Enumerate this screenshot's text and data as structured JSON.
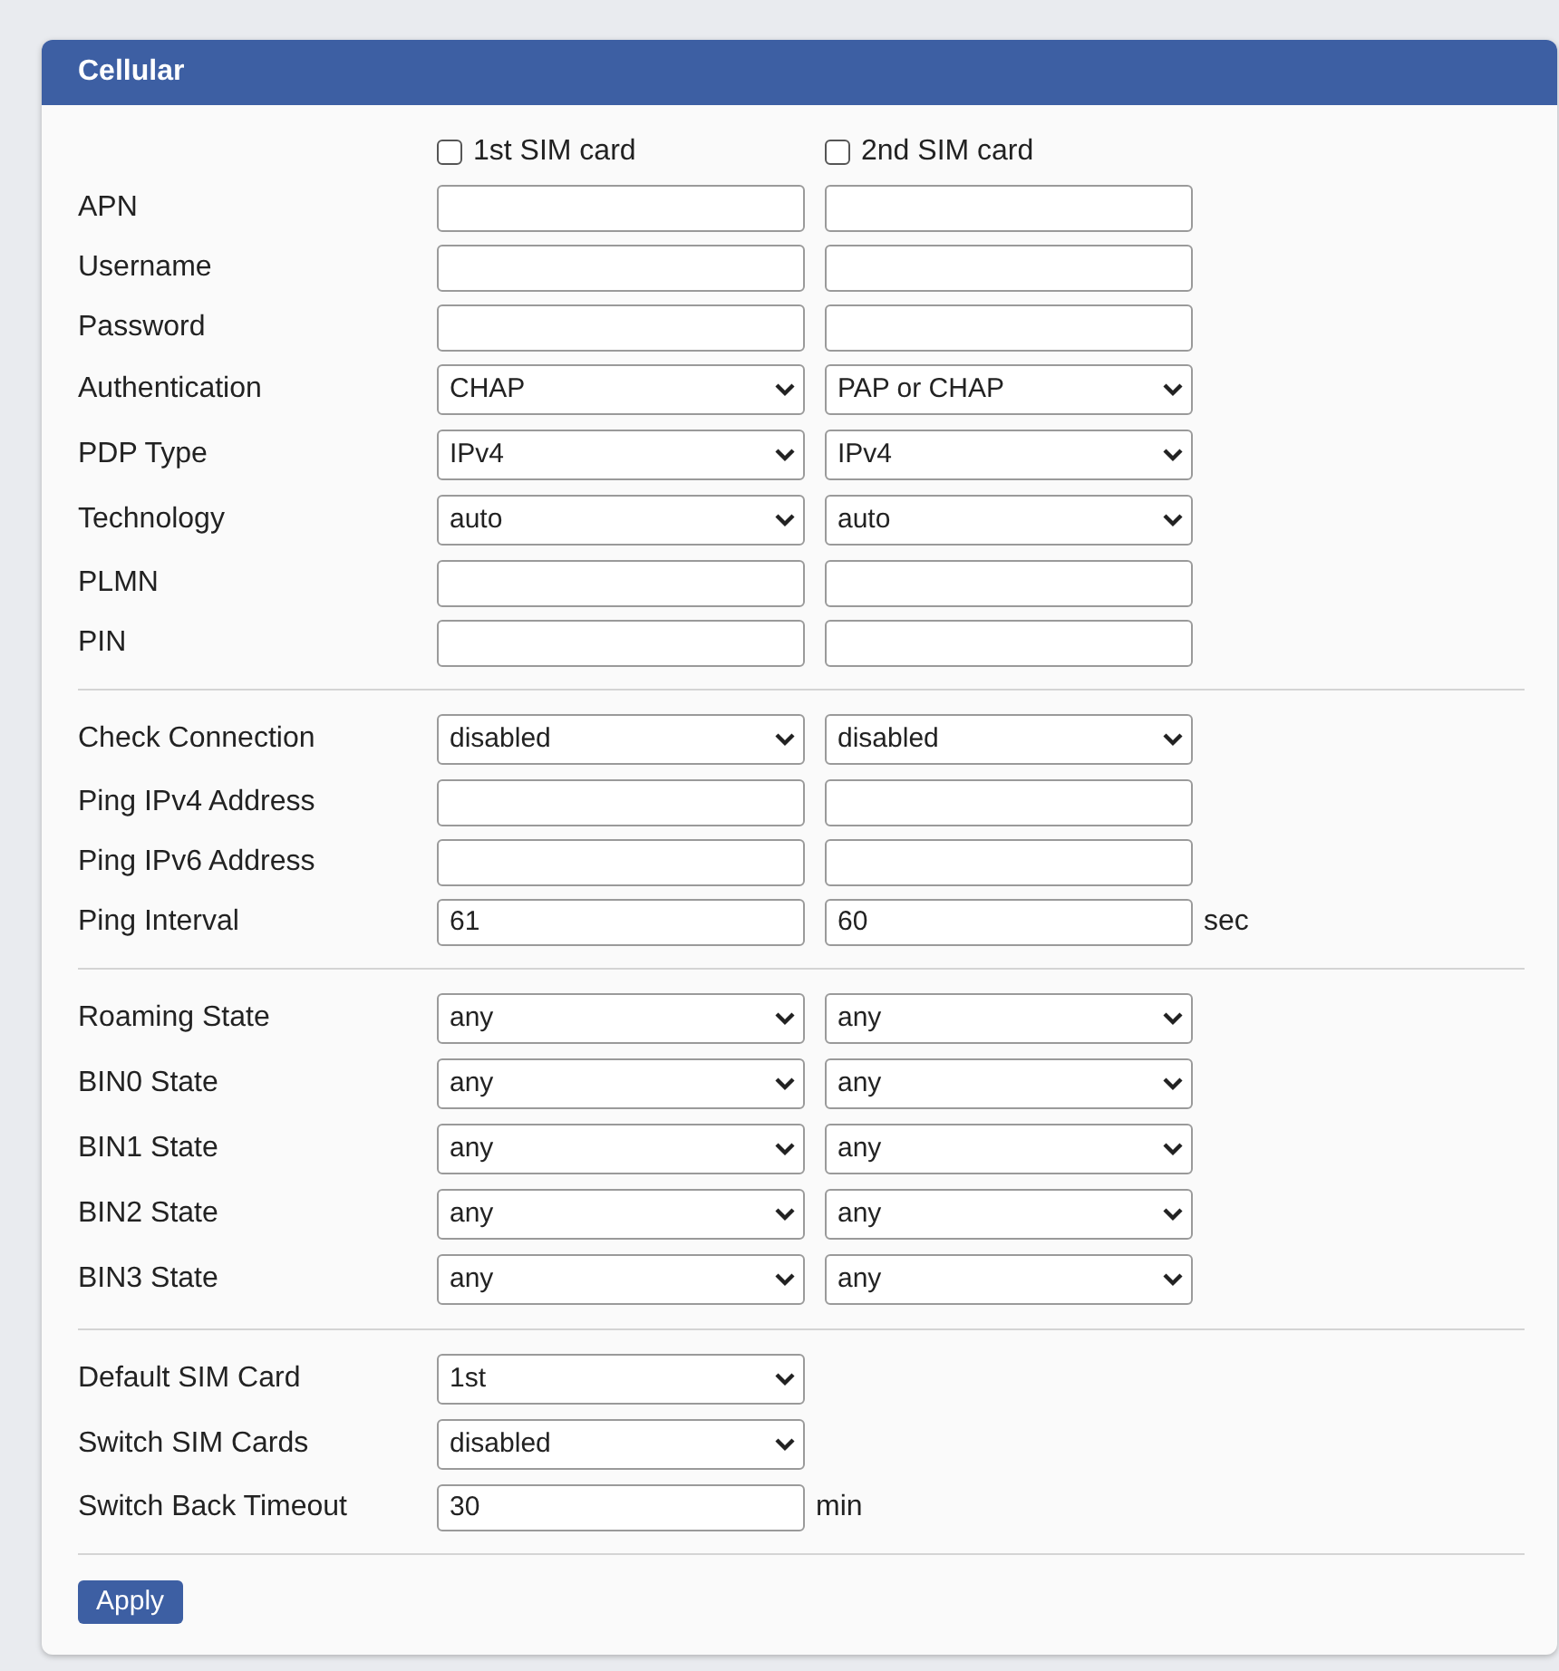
{
  "panel": {
    "title": "Cellular"
  },
  "sim_cards": [
    {
      "label": "1st SIM card",
      "checked": false
    },
    {
      "label": "2nd SIM card",
      "checked": false
    }
  ],
  "sections": [
    {
      "rows": [
        {
          "label": "APN",
          "fields": [
            {
              "kind": "text"
            },
            {
              "kind": "text"
            }
          ]
        },
        {
          "label": "Username",
          "fields": [
            {
              "kind": "text"
            },
            {
              "kind": "text"
            }
          ]
        },
        {
          "label": "Password",
          "fields": [
            {
              "kind": "text"
            },
            {
              "kind": "text"
            }
          ]
        },
        {
          "label": "Authentication",
          "fields": [
            {
              "kind": "select",
              "value": "CHAP"
            },
            {
              "kind": "select",
              "value": "PAP or CHAP"
            }
          ]
        },
        {
          "label": "PDP Type",
          "fields": [
            {
              "kind": "select",
              "value": "IPv4"
            },
            {
              "kind": "select",
              "value": "IPv4"
            }
          ]
        },
        {
          "label": "Technology",
          "fields": [
            {
              "kind": "select",
              "value": "auto"
            },
            {
              "kind": "select",
              "value": "auto"
            }
          ]
        },
        {
          "label": "PLMN",
          "fields": [
            {
              "kind": "text"
            },
            {
              "kind": "text"
            }
          ]
        },
        {
          "label": "PIN",
          "fields": [
            {
              "kind": "text"
            },
            {
              "kind": "text"
            }
          ]
        }
      ]
    },
    {
      "rows": [
        {
          "label": "Check Connection",
          "fields": [
            {
              "kind": "select",
              "value": "disabled"
            },
            {
              "kind": "select",
              "value": "disabled"
            }
          ]
        },
        {
          "label": "Ping IPv4 Address",
          "fields": [
            {
              "kind": "text"
            },
            {
              "kind": "text"
            }
          ]
        },
        {
          "label": "Ping IPv6 Address",
          "fields": [
            {
              "kind": "text"
            },
            {
              "kind": "text"
            }
          ]
        },
        {
          "label": "Ping Interval",
          "fields": [
            {
              "kind": "text",
              "value": "61"
            },
            {
              "kind": "text",
              "value": "60"
            }
          ],
          "unit": "sec"
        }
      ]
    },
    {
      "rows": [
        {
          "label": "Roaming State",
          "fields": [
            {
              "kind": "select",
              "value": "any"
            },
            {
              "kind": "select",
              "value": "any"
            }
          ]
        },
        {
          "label": "BIN0 State",
          "fields": [
            {
              "kind": "select",
              "value": "any"
            },
            {
              "kind": "select",
              "value": "any"
            }
          ]
        },
        {
          "label": "BIN1 State",
          "fields": [
            {
              "kind": "select",
              "value": "any"
            },
            {
              "kind": "select",
              "value": "any"
            }
          ]
        },
        {
          "label": "BIN2 State",
          "fields": [
            {
              "kind": "select",
              "value": "any"
            },
            {
              "kind": "select",
              "value": "any"
            }
          ]
        },
        {
          "label": "BIN3 State",
          "fields": [
            {
              "kind": "select",
              "value": "any"
            },
            {
              "kind": "select",
              "value": "any"
            }
          ]
        }
      ]
    },
    {
      "rows": [
        {
          "label": "Default SIM Card",
          "fields": [
            {
              "kind": "select",
              "value": "1st"
            }
          ]
        },
        {
          "label": "Switch SIM Cards",
          "fields": [
            {
              "kind": "select",
              "value": "disabled"
            }
          ]
        },
        {
          "label": "Switch Back Timeout",
          "fields": [
            {
              "kind": "text",
              "value": "30"
            }
          ],
          "unit": "min"
        }
      ]
    }
  ],
  "apply_button": "Apply"
}
